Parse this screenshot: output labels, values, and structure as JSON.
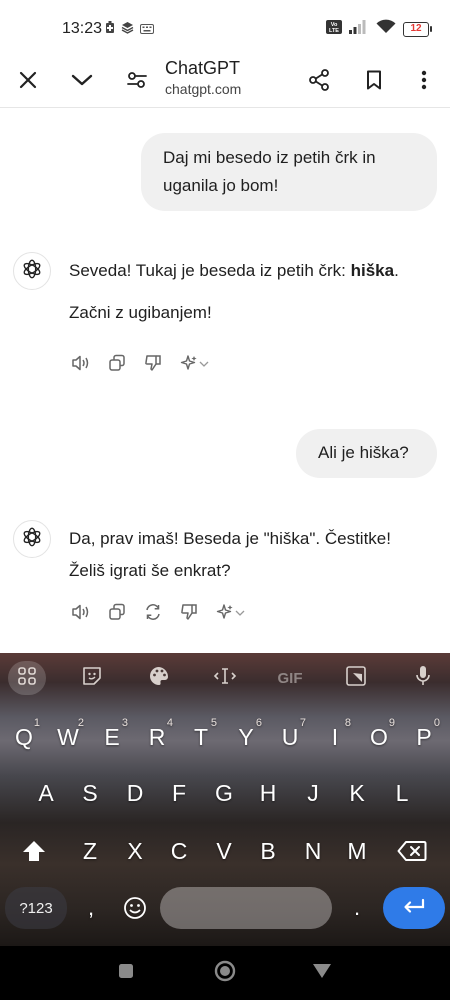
{
  "status": {
    "time": "13:23",
    "battery": "12"
  },
  "header": {
    "title": "ChatGPT",
    "subtitle": "chatgpt.com",
    "icons": [
      "close-icon",
      "chevron-down-icon",
      "tune-icon",
      "share-icon",
      "bookmark-icon",
      "more-icon"
    ]
  },
  "chat": {
    "user_msg_1": "Daj mi besedo iz petih črk in uganila jo bom!",
    "ai_msg_1_pre": "Seveda! Tukaj je beseda iz petih črk: ",
    "ai_msg_1_bold": "hiška",
    "ai_msg_1_post": ".",
    "ai_msg_1_line2": "Začni z ugibanjem!",
    "user_msg_2": "Ali je hiška?",
    "ai_msg_2_line1": "Da, prav imaš! Beseda je \"hiška\". Čestitke!",
    "ai_msg_2_line2": "Želiš igrati še enkrat?"
  },
  "keyboard": {
    "toolbar_gif": "GIF",
    "row1": [
      {
        "k": "Q",
        "h": "1"
      },
      {
        "k": "W",
        "h": "2"
      },
      {
        "k": "E",
        "h": "3"
      },
      {
        "k": "R",
        "h": "4"
      },
      {
        "k": "T",
        "h": "5"
      },
      {
        "k": "Y",
        "h": "6"
      },
      {
        "k": "U",
        "h": "7"
      },
      {
        "k": "I",
        "h": "8"
      },
      {
        "k": "O",
        "h": "9"
      },
      {
        "k": "P",
        "h": "0"
      }
    ],
    "row2": [
      "A",
      "S",
      "D",
      "F",
      "G",
      "H",
      "J",
      "K",
      "L"
    ],
    "row3": [
      "Z",
      "X",
      "C",
      "V",
      "B",
      "N",
      "M"
    ],
    "symbols_label": "?123",
    "comma": ",",
    "period": "."
  },
  "colors": {
    "accent": "#2f7be8",
    "battery_low": "#e53935"
  }
}
